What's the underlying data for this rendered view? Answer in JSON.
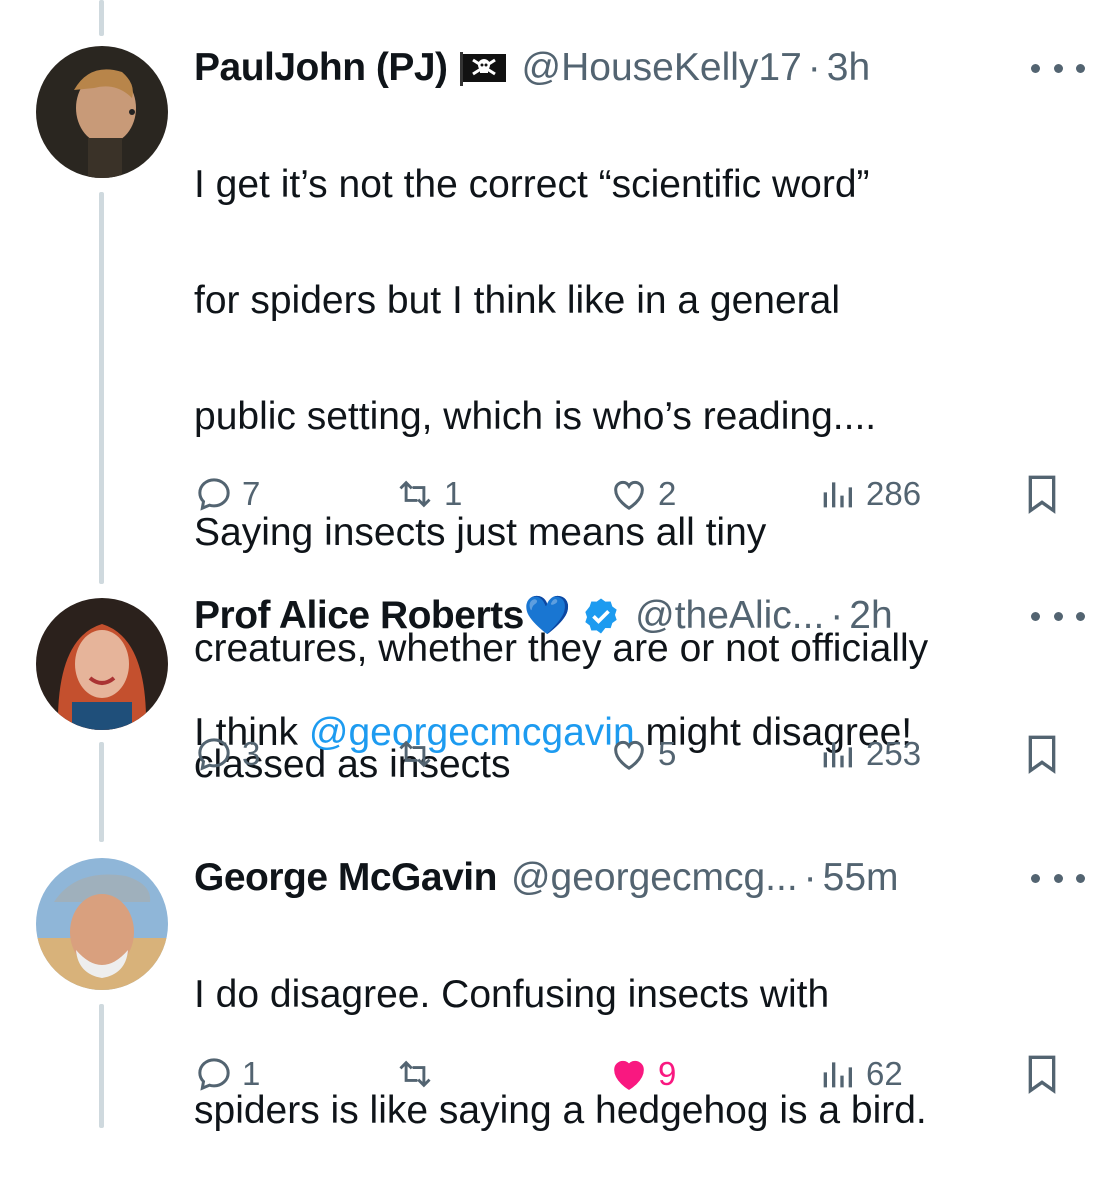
{
  "tweets": [
    {
      "name": "PaulJohn (PJ)",
      "flag_icon": "pirate-flag-icon",
      "handle": "@HouseKelly17",
      "time": "3h",
      "text_lines": [
        "I get it’s not the correct “scientific word”",
        "for spiders but I think like in a general",
        "public setting, which is who’s reading....",
        "Saying insects just means all tiny",
        "creatures, whether they are or not officially",
        "classed as insects"
      ],
      "replies": "7",
      "retweets": "1",
      "likes": "2",
      "views": "286",
      "liked": false
    },
    {
      "name": "Prof Alice Roberts",
      "name_emoji": "💙",
      "verified": true,
      "handle": "@theAlic...",
      "time": "2h",
      "text_prefix": "I think ",
      "mention": "@georgecmcgavin",
      "text_suffix": " might disagree!",
      "replies": "3",
      "retweets": "",
      "likes": "5",
      "views": "253",
      "liked": false
    },
    {
      "name": "George McGavin",
      "handle": "@georgecmcg...",
      "time": "55m",
      "text_lines": [
        "I do disagree. Confusing insects with",
        "spiders is like saying a hedgehog is a bird."
      ],
      "replies": "1",
      "retweets": "",
      "likes": "9",
      "views": "62",
      "liked": true
    }
  ],
  "colors": {
    "text": "#0f1419",
    "secondary": "#536471",
    "link": "#1d9bf0",
    "like_active": "#f91880",
    "thread_line": "#cfd9de"
  },
  "separator": "·"
}
